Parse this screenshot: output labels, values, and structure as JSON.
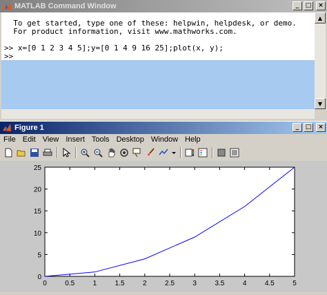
{
  "command_window": {
    "title": "MATLAB Command Window",
    "lines": [
      "  To get started, type one of these: helpwin, helpdesk, or demo.",
      "  For product information, visit www.mathworks.com.",
      "",
      ">> x=[0 1 2 3 4 5];y=[0 1 4 9 16 25];plot(x, y);",
      ">>"
    ],
    "controls": {
      "minimize": "_",
      "maximize": "□",
      "close": "×"
    }
  },
  "figure_window": {
    "title": "Figure 1",
    "menu": [
      "File",
      "Edit",
      "View",
      "Insert",
      "Tools",
      "Desktop",
      "Window",
      "Help"
    ],
    "toolbar": [
      "new-figure-icon",
      "open-file-icon",
      "save-icon",
      "print-icon",
      "edit-plot-icon",
      "zoom-in-icon",
      "zoom-out-icon",
      "pan-icon",
      "rotate-3d-icon",
      "data-cursor-icon",
      "brush-icon",
      "link-icon",
      "insert-colorbar-icon",
      "insert-legend-icon",
      "hide-plot-tools-icon",
      "show-plot-tools-icon"
    ],
    "controls": {
      "minimize": "_",
      "maximize": "□",
      "close": "×"
    }
  },
  "chart_data": {
    "type": "line",
    "x": [
      0,
      1,
      2,
      3,
      4,
      5
    ],
    "y": [
      0,
      1,
      4,
      9,
      16,
      25
    ],
    "xlim": [
      0,
      5
    ],
    "ylim": [
      0,
      25
    ],
    "xticks": [
      "0",
      "0.5",
      "1",
      "1.5",
      "2",
      "2.5",
      "3",
      "3.5",
      "4",
      "4.5",
      "5"
    ],
    "yticks": [
      "0",
      "5",
      "10",
      "15",
      "20",
      "25"
    ],
    "line_color": "#0000ff",
    "grid": false
  },
  "colors": {
    "window_bg": "#d4d0c8",
    "selection": "#a6caf0",
    "active_title": "#0a246a"
  }
}
